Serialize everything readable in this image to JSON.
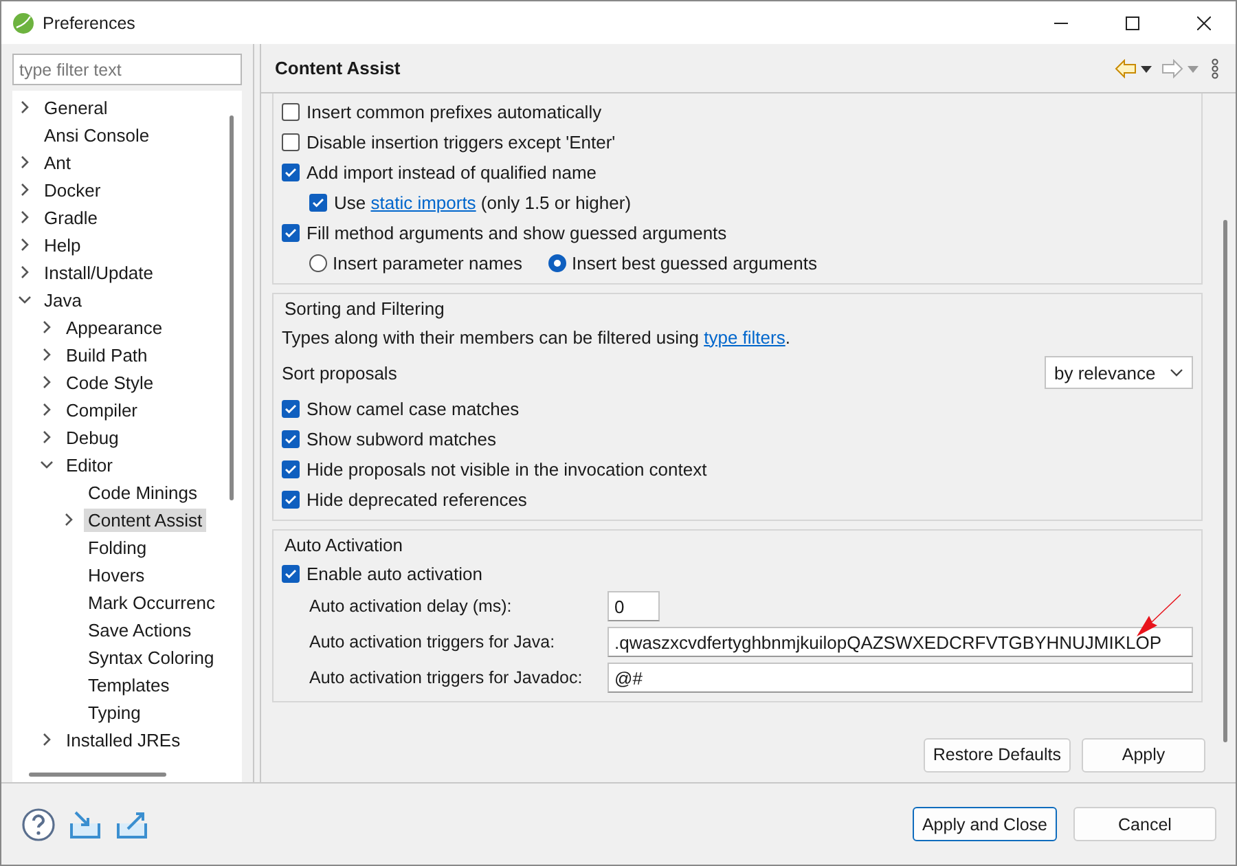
{
  "window": {
    "title": "Preferences"
  },
  "filter": {
    "placeholder": "type filter text"
  },
  "tree": [
    {
      "label": "General",
      "kind": "folder",
      "expanded": false,
      "selected": false
    },
    {
      "label": "Ansi Console",
      "kind": "leaf",
      "selected": false
    },
    {
      "label": "Ant",
      "kind": "folder",
      "expanded": false,
      "selected": false
    },
    {
      "label": "Docker",
      "kind": "folder",
      "expanded": false,
      "selected": false
    },
    {
      "label": "Gradle",
      "kind": "folder",
      "expanded": false,
      "selected": false
    },
    {
      "label": "Help",
      "kind": "folder",
      "expanded": false,
      "selected": false
    },
    {
      "label": "Install/Update",
      "kind": "folder",
      "expanded": false,
      "selected": false
    },
    {
      "label": "Java",
      "kind": "folder",
      "expanded": true,
      "selected": false,
      "children": [
        {
          "label": "Appearance",
          "kind": "folder",
          "expanded": false,
          "selected": false
        },
        {
          "label": "Build Path",
          "kind": "folder",
          "expanded": false,
          "selected": false
        },
        {
          "label": "Code Style",
          "kind": "folder",
          "expanded": false,
          "selected": false
        },
        {
          "label": "Compiler",
          "kind": "folder",
          "expanded": false,
          "selected": false
        },
        {
          "label": "Debug",
          "kind": "folder",
          "expanded": false,
          "selected": false
        },
        {
          "label": "Editor",
          "kind": "folder",
          "expanded": true,
          "selected": false,
          "children": [
            {
              "label": "Code Minings",
              "kind": "leaf",
              "selected": false
            },
            {
              "label": "Content Assist",
              "kind": "folder",
              "expanded": false,
              "selected": true
            },
            {
              "label": "Folding",
              "kind": "leaf",
              "selected": false
            },
            {
              "label": "Hovers",
              "kind": "leaf",
              "selected": false
            },
            {
              "label": "Mark Occurrenc",
              "kind": "leaf",
              "selected": false
            },
            {
              "label": "Save Actions",
              "kind": "leaf",
              "selected": false
            },
            {
              "label": "Syntax Coloring",
              "kind": "leaf",
              "selected": false
            },
            {
              "label": "Templates",
              "kind": "leaf",
              "selected": false
            },
            {
              "label": "Typing",
              "kind": "leaf",
              "selected": false
            }
          ]
        },
        {
          "label": "Installed JREs",
          "kind": "folder",
          "expanded": false,
          "selected": false
        }
      ]
    }
  ],
  "page": {
    "title": "Content Assist"
  },
  "sections": [
    {
      "rows": [
        {
          "kind": "checkbox",
          "checked": false,
          "parts": [
            {
              "text": "Insert common prefixes automatically"
            }
          ]
        },
        {
          "kind": "checkbox",
          "checked": false,
          "parts": [
            {
              "text": "Disable insertion triggers except 'Enter'"
            }
          ]
        },
        {
          "kind": "checkbox",
          "checked": true,
          "parts": [
            {
              "text": "Add import instead of qualified name"
            }
          ],
          "children": [
            {
              "kind": "checkbox",
              "checked": true,
              "parts": [
                {
                  "text": "Use "
                },
                {
                  "text": "static imports",
                  "link": true
                },
                {
                  "text": " (only 1.5 or higher)"
                }
              ]
            }
          ]
        },
        {
          "kind": "checkbox",
          "checked": true,
          "parts": [
            {
              "text": "Fill method arguments and show guessed arguments"
            }
          ],
          "children": [
            {
              "kind": "radios",
              "options": [
                {
                  "label": "Insert parameter names",
                  "selected": false
                },
                {
                  "label": "Insert best guessed arguments",
                  "selected": true
                }
              ]
            }
          ]
        }
      ]
    },
    {
      "title": "Sorting and Filtering",
      "rows": [
        {
          "kind": "text",
          "parts": [
            {
              "text": "Types along with their members can be filtered using "
            },
            {
              "text": "type filters",
              "link": true
            },
            {
              "text": "."
            }
          ]
        },
        {
          "kind": "select",
          "label": "Sort proposals",
          "value": "by relevance"
        },
        {
          "kind": "checkbox",
          "checked": true,
          "parts": [
            {
              "text": "Show camel case matches"
            }
          ]
        },
        {
          "kind": "checkbox",
          "checked": true,
          "parts": [
            {
              "text": "Show subword matches"
            }
          ]
        },
        {
          "kind": "checkbox",
          "checked": true,
          "parts": [
            {
              "text": "Hide proposals not visible in the invocation context"
            }
          ]
        },
        {
          "kind": "checkbox",
          "checked": true,
          "parts": [
            {
              "text": "Hide deprecated references"
            }
          ]
        }
      ]
    },
    {
      "title": "Auto Activation",
      "rows": [
        {
          "kind": "checkbox",
          "checked": true,
          "parts": [
            {
              "text": "Enable auto activation"
            }
          ]
        },
        {
          "kind": "field",
          "label": "Auto activation delay (ms):",
          "value": "0",
          "short": true
        },
        {
          "kind": "field",
          "label": "Auto activation triggers for Java:",
          "value": ".qwaszxcvdfertyghbnmjkuilopQAZSWXEDCRFVTGBYHNUJMIKLOP",
          "short": false,
          "arrow": true
        },
        {
          "kind": "field",
          "label": "Auto activation triggers for Javadoc:",
          "value": "@#",
          "short": false
        }
      ]
    }
  ],
  "page_buttons": [
    "Restore Defaults",
    "Apply"
  ],
  "dialog_buttons": [
    {
      "label": "Apply and Close",
      "default": true
    },
    {
      "label": "Cancel",
      "default": false
    }
  ]
}
